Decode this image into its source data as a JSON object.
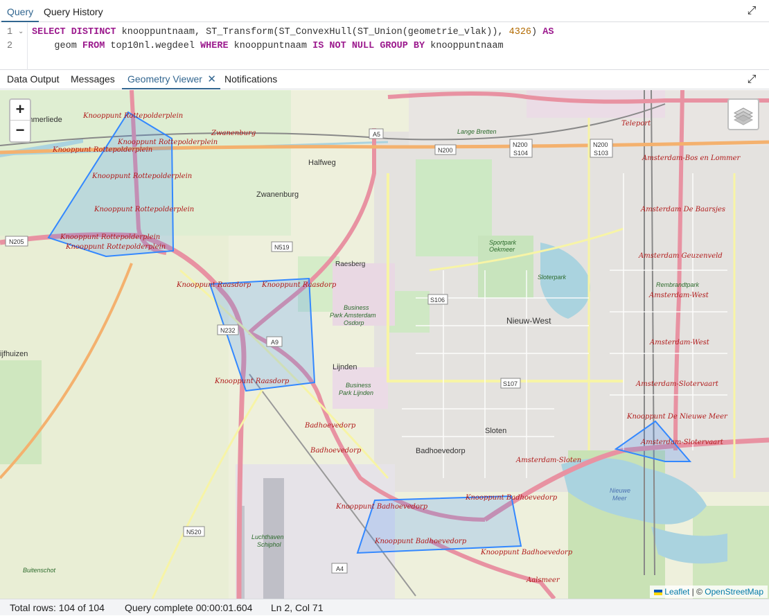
{
  "top_tabs": [
    {
      "label": "Query"
    },
    {
      "label": "Query History"
    }
  ],
  "editor": {
    "line_numbers": [
      "1",
      "2"
    ],
    "line1": {
      "kw1": "SELECT DISTINCT",
      "t1": " knooppuntnaam, ST_Transform(ST_ConvexHull(ST_Union(geometrie_vlak)), ",
      "num": "4326",
      "t2": ") ",
      "kw2": "AS"
    },
    "line2": {
      "t0": "    geom ",
      "kw1": "FROM",
      "t1": " top10nl.wegdeel ",
      "kw2": "WHERE",
      "t2": " knooppuntnaam ",
      "kw3": "IS NOT NULL GROUP BY",
      "t3": " knooppuntnaam"
    }
  },
  "result_tabs": [
    {
      "label": "Data Output"
    },
    {
      "label": "Messages"
    },
    {
      "label": "Geometry Viewer"
    },
    {
      "label": "Notifications"
    }
  ],
  "map": {
    "zoom_in": "+",
    "zoom_out": "−",
    "attribution": {
      "leaflet": "Leaflet",
      "sep": " | © ",
      "osm": "OpenStreetMap"
    },
    "polygon_color": "#3388ff",
    "place_labels": [
      "Zwanenburg",
      "Halfweg",
      "Raesberg",
      "Lijnden",
      "Nieuw-West",
      "Sloten",
      "Badhoevedorp",
      "Sloterpark",
      "Sportpark Oekmeer",
      "Business Park Amsterdam Osdorp",
      "Business Park Lijnden",
      "Luchthaven Schiphol",
      "Nieuwe Meer",
      "Lange Bretten",
      "Buitenschot",
      "ijfhuizen",
      "arlemmerliede"
    ],
    "junction_labels": [
      "Knooppunt Rottepolderplein",
      "Knooppunt Raasdorp",
      "Knooppunt Badhoevedorp",
      "Knooppunt De Nieuwe Meer",
      "Badhoevedorp",
      "Amsterdam-Sloten",
      "Amsterdam-Slotervaart",
      "Amsterdam-West",
      "Amsterdam Geuzenveld",
      "Amsterdam De Baarsjes",
      "Amsterdam-Bos en Lommer",
      "Rembrandtpark",
      "Zwanenburg",
      "Teleport",
      "Aalsmeer"
    ],
    "road_refs": [
      "N205",
      "N519",
      "N232",
      "A9",
      "A5",
      "N200",
      "S104",
      "S103",
      "S106",
      "S107",
      "N520",
      "A4"
    ]
  },
  "status": {
    "rows": "Total rows: 104 of 104",
    "query": "Query complete 00:00:01.604",
    "pos": "Ln 2, Col 71"
  }
}
